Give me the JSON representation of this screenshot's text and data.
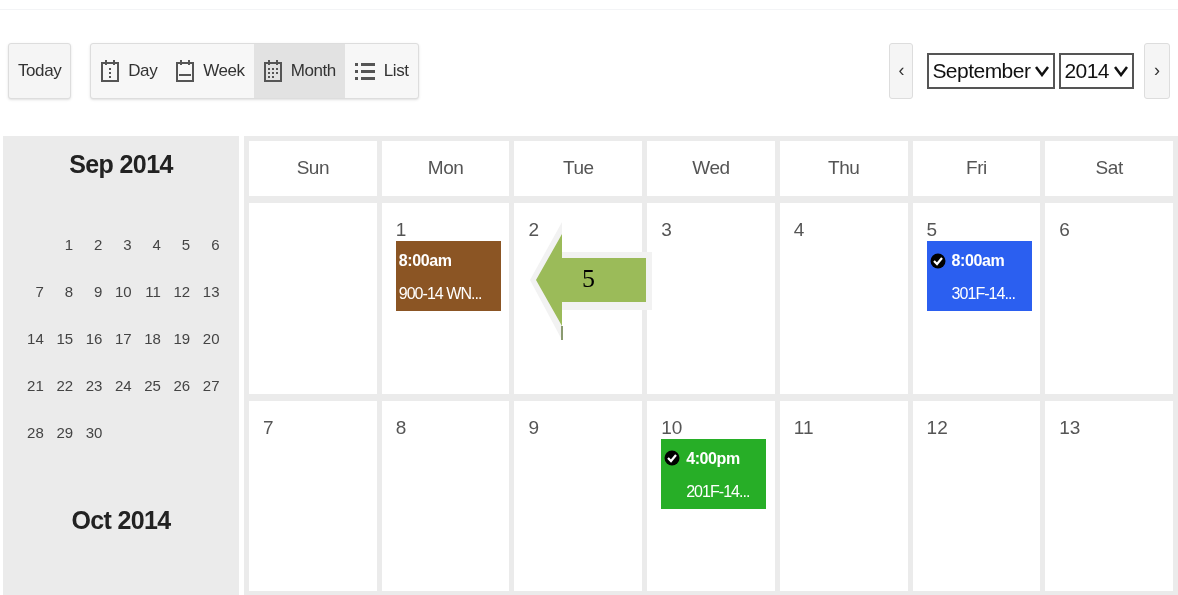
{
  "toolbar": {
    "today": "Today",
    "views": [
      {
        "label": "Day",
        "kind": "day",
        "selected": false
      },
      {
        "label": "Week",
        "kind": "week",
        "selected": false
      },
      {
        "label": "Month",
        "kind": "month",
        "selected": true
      },
      {
        "label": "List",
        "kind": "list",
        "selected": false
      }
    ],
    "prev": "‹",
    "next": "›",
    "month_select": "September",
    "year_select": "2014"
  },
  "mini_calendar": {
    "title": "Sep 2014",
    "weeks": [
      {
        "kind": "lead",
        "days": [
          "1",
          "2",
          "3",
          "4",
          "5",
          "6"
        ]
      },
      {
        "kind": "full",
        "days": [
          "7",
          "8",
          "9",
          "10",
          "11",
          "12",
          "13"
        ]
      },
      {
        "kind": "full",
        "days": [
          "14",
          "15",
          "16",
          "17",
          "18",
          "19",
          "20"
        ]
      },
      {
        "kind": "full",
        "days": [
          "21",
          "22",
          "23",
          "24",
          "25",
          "26",
          "27"
        ]
      },
      {
        "kind": "tail",
        "days": [
          "28",
          "29",
          "30"
        ]
      }
    ],
    "next_title": "Oct 2014"
  },
  "calendar": {
    "weekdays": [
      "Sun",
      "Mon",
      "Tue",
      "Wed",
      "Thu",
      "Fri",
      "Sat"
    ],
    "weeks": [
      {
        "kind": "lead",
        "days": [
          {
            "day": "1",
            "events": [
              {
                "time": "8:00am",
                "title": "900-14 WN...",
                "color": "#8b5524",
                "checked": false
              }
            ]
          },
          {
            "day": "2"
          },
          {
            "day": "3"
          },
          {
            "day": "4"
          },
          {
            "day": "5",
            "events": [
              {
                "time": "8:00am",
                "title": "301F-14...",
                "color": "#2b5ff0",
                "checked": true
              }
            ]
          },
          {
            "day": "6"
          }
        ]
      },
      {
        "kind": "full",
        "days": [
          {
            "day": "7"
          },
          {
            "day": "8"
          },
          {
            "day": "9"
          },
          {
            "day": "10",
            "events": [
              {
                "time": "4:00pm",
                "title": "201F-14...",
                "color": "#27ae27",
                "checked": true
              }
            ]
          },
          {
            "day": "11"
          },
          {
            "day": "12"
          },
          {
            "day": "13"
          }
        ]
      }
    ]
  },
  "callout": {
    "label": "5"
  }
}
